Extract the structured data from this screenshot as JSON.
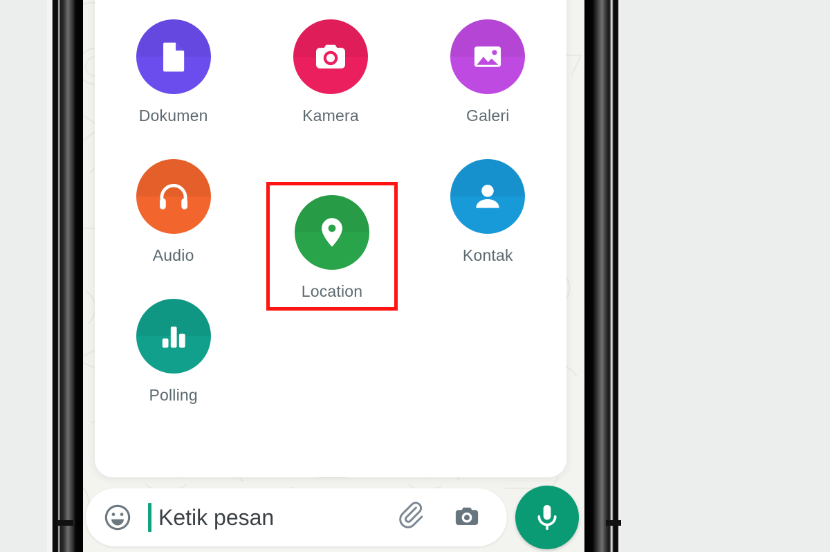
{
  "app": {
    "name": "WhatsApp",
    "screen": "attachment-picker"
  },
  "attachment_panel": {
    "items": [
      {
        "label": "Dokumen",
        "icon": "document-icon",
        "color": "#6b4ded"
      },
      {
        "label": "Kamera",
        "icon": "camera-icon",
        "color": "#ec1f5e"
      },
      {
        "label": "Galeri",
        "icon": "gallery-icon",
        "color": "#bf4ae2"
      },
      {
        "label": "Audio",
        "icon": "headphones-icon",
        "color": "#f2652c"
      },
      {
        "label": "Location",
        "icon": "location-pin-icon",
        "color": "#2aa44a"
      },
      {
        "label": "Kontak",
        "icon": "contact-icon",
        "color": "#189ad9"
      },
      {
        "label": "Polling",
        "icon": "poll-bars-icon",
        "color": "#11a08c"
      }
    ],
    "highlighted_item": "Location",
    "highlight_color": "#ff1414"
  },
  "composer": {
    "emoji_icon": "smiley-icon",
    "message_text": "Ketik pesan",
    "attach_icon": "paperclip-icon",
    "camera_icon": "camera-icon",
    "mic_icon": "microphone-icon",
    "mic_button_color": "#0b9b74",
    "caret_color": "#11a37f"
  }
}
